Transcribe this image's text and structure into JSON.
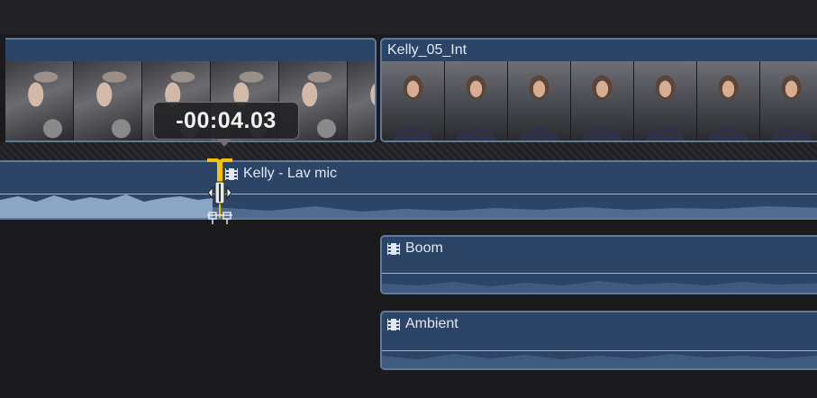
{
  "clips": {
    "video_left": {
      "name": ""
    },
    "video_right": {
      "name": "Kelly_05_Int"
    }
  },
  "audio": {
    "main": {
      "name": "Kelly - Lav mic"
    },
    "boom": {
      "name": "Boom"
    },
    "ambient": {
      "name": "Ambient"
    }
  },
  "trim": {
    "timecode": "-00:04.03"
  },
  "icons": [
    "film-icon",
    "trim-handle-icon"
  ],
  "colors": {
    "clip_fill": "#2c4566",
    "clip_border": "#5f7a9c",
    "trim_accent": "#f5c400",
    "background": "#1b1b1d"
  }
}
